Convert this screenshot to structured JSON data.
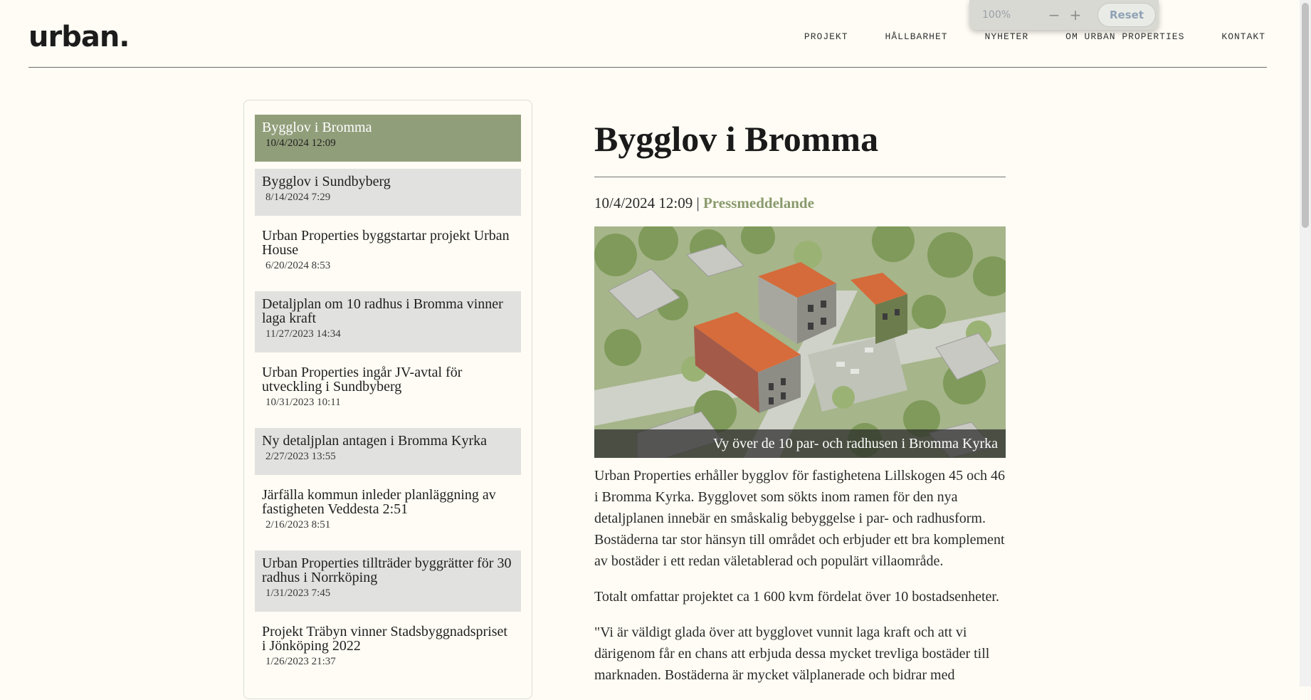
{
  "header": {
    "logo": "urban.",
    "nav": [
      "PROJEKT",
      "HÅLLBARHET",
      "NYHETER",
      "OM URBAN PROPERTIES",
      "KONTAKT"
    ]
  },
  "zoom": {
    "level": "100%",
    "minus": "−",
    "plus": "+",
    "reset": "Reset"
  },
  "sidebar": {
    "items": [
      {
        "title": "Bygglov i Bromma",
        "date": "10/4/2024 12:09"
      },
      {
        "title": "Bygglov i Sundbyberg",
        "date": "8/14/2024 7:29"
      },
      {
        "title": "Urban Properties byggstartar projekt Urban House",
        "date": "6/20/2024 8:53"
      },
      {
        "title": "Detaljplan om 10 radhus i Bromma vinner laga kraft",
        "date": "11/27/2023 14:34"
      },
      {
        "title": "Urban Properties ingår JV-avtal för utveckling i Sundbyberg",
        "date": "10/31/2023 10:11"
      },
      {
        "title": "Ny detaljplan antagen i Bromma Kyrka",
        "date": "2/27/2023 13:55"
      },
      {
        "title": "Järfälla kommun inleder planläggning av fastigheten Veddesta 2:51",
        "date": "2/16/2023 8:51"
      },
      {
        "title": "Urban Properties tillträder byggrätter för 30 radhus i Norrköping",
        "date": "1/31/2023 7:45"
      },
      {
        "title": "Projekt Träbyn vinner Stadsbyggnadspriset i Jönköping 2022",
        "date": "1/26/2023 21:37"
      }
    ]
  },
  "article": {
    "title": "Bygglov i Bromma",
    "date": "10/4/2024 12:09",
    "separator": " | ",
    "category": "Pressmeddelande",
    "image_caption": "Vy över de 10 par- och radhusen i Bromma Kyrka",
    "paragraphs": [
      "Urban Properties erhåller bygglov för fastighetena Lillskogen 45 och 46 i Bromma Kyrka. Bygglovet som sökts inom ramen för den nya detaljplanen innebär en småskalig bebyggelse i par- och radhusform. Bostäderna tar stor hänsyn till området och erbjuder ett bra komplement av bostäder i ett redan väletablerad och populärt villaområde.",
      "Totalt omfattar projektet ca 1 600 kvm fördelat över 10 bostadsenheter.",
      "\"Vi är väldigt glada över att bygglovet vunnit laga kraft och att vi därigenom får en chans att erbjuda dessa mycket trevliga bostäder till marknaden. Bostäderna är mycket välplanerade och bidrar med"
    ]
  },
  "colors": {
    "active": "#919e7a",
    "alt": "#e1e1e0",
    "accent": "#8a9a6e",
    "background": "#fefcf4"
  }
}
